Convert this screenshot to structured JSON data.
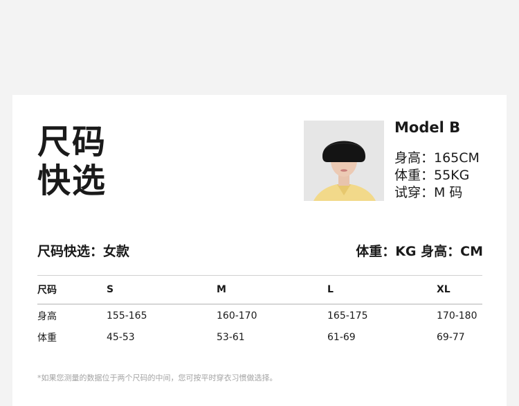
{
  "title": {
    "line1": "尺码",
    "line2": "快选"
  },
  "model": {
    "photo_icon": "model-portrait",
    "name": "Model B",
    "height": "身高：165CM",
    "weight": "体重：55KG",
    "trial": "试穿：M 码"
  },
  "quick_select": {
    "label": "尺码快选：女款",
    "units": "体重：KG  身高：CM"
  },
  "size_table": {
    "headers": [
      "尺码",
      "S",
      "M",
      "L",
      "XL"
    ],
    "rows": [
      [
        "身高",
        "155-165",
        "160-170",
        "165-175",
        "170-180"
      ],
      [
        "体重",
        "45-53",
        "53-61",
        "61-69",
        "69-77"
      ]
    ]
  },
  "footnote": "*如果您测量的数据位于两个尺码的中间，您可按平时穿衣习惯做选择。",
  "colors": {
    "background": "#f3f3f3",
    "card": "#ffffff",
    "text": "#1a1a1a",
    "muted": "#a3a3a3",
    "shirt": "#f2d98a",
    "hair": "#141414"
  }
}
